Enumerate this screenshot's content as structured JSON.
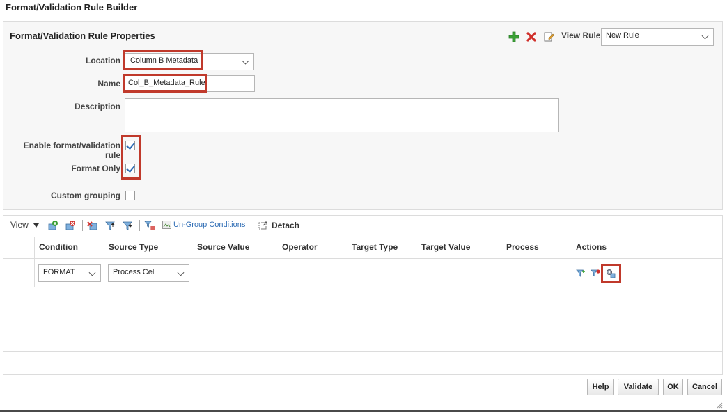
{
  "window": {
    "title": "Format/Validation Rule Builder"
  },
  "properties": {
    "title": "Format/Validation Rule Properties",
    "view_rule_label": "View Rule",
    "view_rule_value": "New Rule",
    "location_label": "Location",
    "location_value": "Column B Metadata",
    "name_label": "Name",
    "name_value": "Col_B_Metadata_Rule",
    "description_label": "Description",
    "description_value": "",
    "enable_label": "Enable format/validation rule",
    "enable_checked": true,
    "format_only_label": "Format Only",
    "format_only_checked": true,
    "custom_grouping_label": "Custom grouping",
    "custom_grouping_checked": false
  },
  "toolbar": {
    "view_label": "View",
    "ungroup_label": "Un-Group Conditions",
    "detach_label": "Detach"
  },
  "table": {
    "columns": [
      "Condition",
      "Source Type",
      "Source Value",
      "Operator",
      "Target Type",
      "Target Value",
      "Process",
      "Actions"
    ],
    "rows": [
      {
        "condition": "FORMAT",
        "source_type": "Process Cell"
      }
    ]
  },
  "footer": {
    "help_label": "Help",
    "validate_label": "Validate",
    "ok_label": "OK",
    "cancel_label": "Cancel"
  },
  "colors": {
    "highlight": "#c0392b",
    "accent_blue": "#2f6db5",
    "add_green": "#3aa035",
    "delete_red": "#d0302b"
  }
}
